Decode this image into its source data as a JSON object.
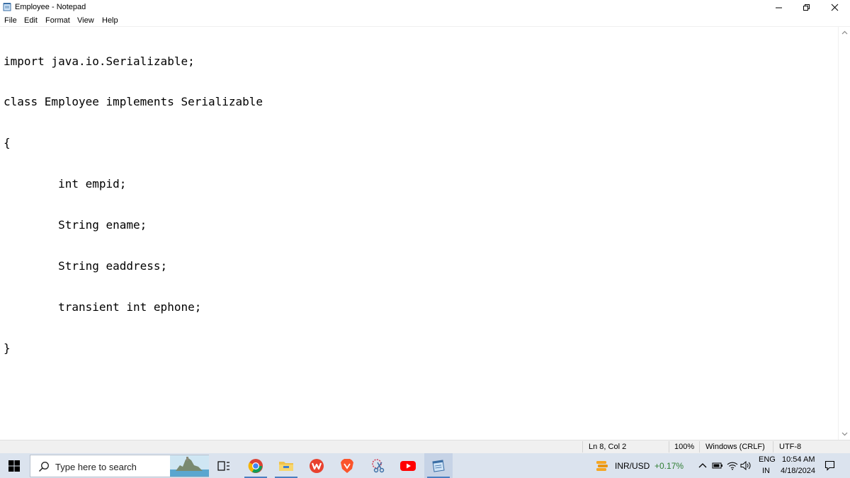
{
  "window": {
    "title": "Employee - Notepad",
    "icon": "notepad-icon"
  },
  "menu": [
    "File",
    "Edit",
    "Format",
    "View",
    "Help"
  ],
  "editor": {
    "lines": [
      "import java.io.Serializable;",
      "class Employee implements Serializable",
      "{",
      "\tint empid;",
      "\tString ename;",
      "\tString eaddress;",
      "\ttransient int ephone;",
      "}"
    ]
  },
  "status": {
    "position": "Ln 8, Col 2",
    "zoom": "100%",
    "line_ending": "Windows (CRLF)",
    "encoding": "UTF-8"
  },
  "taskbar": {
    "search_placeholder": "Type here to search",
    "apps": [
      "task-view-icon",
      "chrome-icon",
      "file-explorer-icon",
      "wps-office-icon",
      "brave-icon",
      "snipping-tool-icon",
      "youtube-icon",
      "notepad-icon"
    ],
    "widget": {
      "label": "INR/USD",
      "change": "+0.17%",
      "change_color": "#2e7d32"
    },
    "tray": {
      "lang_top": "ENG",
      "lang_bottom": "IN",
      "time": "10:54 AM",
      "date": "4/18/2024"
    }
  }
}
